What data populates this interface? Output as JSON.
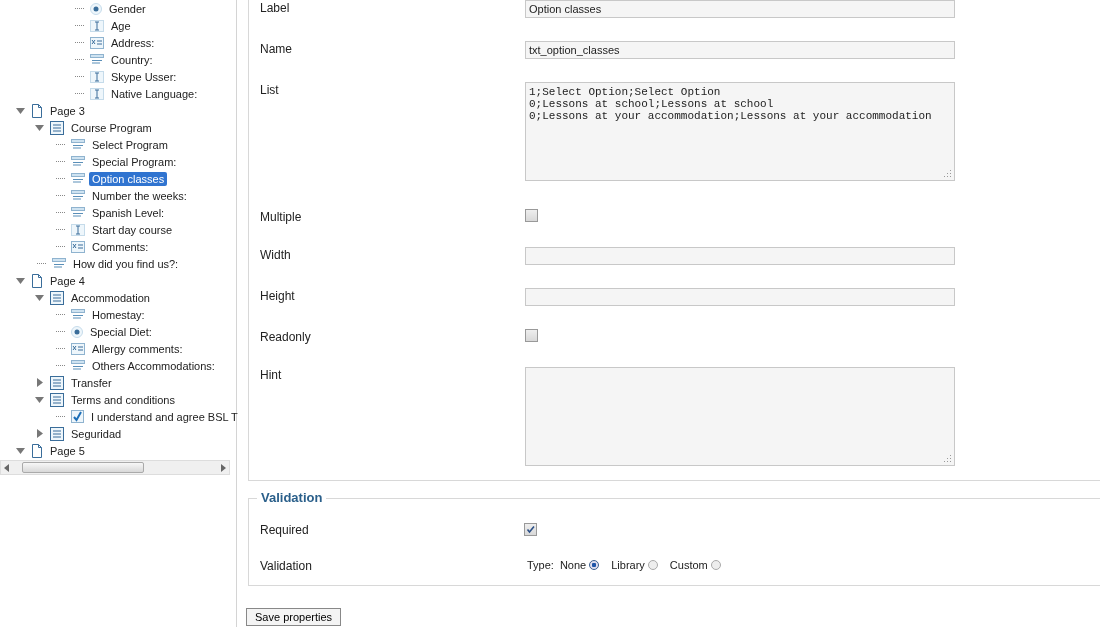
{
  "tree": {
    "continued": [
      {
        "label": "Gender",
        "kind": "radio",
        "selected": false
      },
      {
        "label": "Age",
        "kind": "textfield",
        "selected": false
      },
      {
        "label": "Address:",
        "kind": "textarea",
        "selected": false
      },
      {
        "label": "Country:",
        "kind": "select",
        "selected": false
      },
      {
        "label": "Skype Usser:",
        "kind": "textfield",
        "selected": false
      },
      {
        "label": "Native Language:",
        "kind": "textfield",
        "selected": false
      }
    ],
    "items": [
      {
        "label": "Page 3",
        "kind": "page",
        "selected": false,
        "expanded": true,
        "children": [
          {
            "label": "Course Program",
            "kind": "section",
            "selected": false,
            "expanded": true,
            "children": [
              {
                "label": "Select Program",
                "kind": "select",
                "selected": false
              },
              {
                "label": "Special Program:",
                "kind": "select",
                "selected": false
              },
              {
                "label": "Option classes",
                "kind": "select",
                "selected": true
              },
              {
                "label": "Number the weeks:",
                "kind": "select",
                "selected": false
              },
              {
                "label": "Spanish Level:",
                "kind": "select",
                "selected": false
              },
              {
                "label": "Start day course",
                "kind": "textfield",
                "selected": false
              },
              {
                "label": "Comments:",
                "kind": "textarea",
                "selected": false
              }
            ]
          },
          {
            "label": "How did you find us?:",
            "kind": "select",
            "selected": false
          }
        ]
      },
      {
        "label": "Page 4",
        "kind": "page",
        "selected": false,
        "expanded": true,
        "children": [
          {
            "label": "Accommodation",
            "kind": "section",
            "selected": false,
            "expanded": true,
            "children": [
              {
                "label": "Homestay:",
                "kind": "select",
                "selected": false
              },
              {
                "label": "Special Diet:",
                "kind": "radio",
                "selected": false
              },
              {
                "label": "Allergy comments:",
                "kind": "textarea",
                "selected": false
              },
              {
                "label": "Others Accommodations:",
                "kind": "select",
                "selected": false
              }
            ]
          },
          {
            "label": "Transfer",
            "kind": "section",
            "selected": false,
            "expanded": false
          },
          {
            "label": "Terms and conditions",
            "kind": "section",
            "selected": false,
            "expanded": true,
            "children": [
              {
                "label": "I understand and agree BSL T",
                "kind": "checkbox",
                "selected": false
              }
            ]
          },
          {
            "label": "Seguridad",
            "kind": "section",
            "selected": false,
            "expanded": false
          }
        ]
      },
      {
        "label": "Page 5",
        "kind": "page",
        "selected": false,
        "expanded": true
      }
    ]
  },
  "properties": [
    {
      "label": "Label",
      "kind": "text",
      "value": "Option classes"
    },
    {
      "label": "Name",
      "kind": "text",
      "value": "txt_option_classes"
    },
    {
      "label": "List",
      "kind": "textarea",
      "value": "1;Select Option;Select Option\n0;Lessons at school;Lessons at school\n0;Lessons at your accommodation;Lessons at your accommodation"
    },
    {
      "label": "Multiple",
      "kind": "checkbox",
      "checked": false
    },
    {
      "label": "Width",
      "kind": "text"
    },
    {
      "label": "Height",
      "kind": "text"
    },
    {
      "label": "Readonly",
      "kind": "checkbox",
      "checked": false
    },
    {
      "label": "Hint",
      "kind": "textarea"
    }
  ],
  "validation": {
    "legend": "Validation",
    "required": {
      "label": "Required",
      "checked": true
    },
    "type": {
      "label": "Validation",
      "prefix": "Type:",
      "options": [
        {
          "label": "None",
          "selected": true
        },
        {
          "label": "Library",
          "selected": false
        },
        {
          "label": "Custom",
          "selected": false
        }
      ]
    }
  },
  "save_button": "Save properties"
}
